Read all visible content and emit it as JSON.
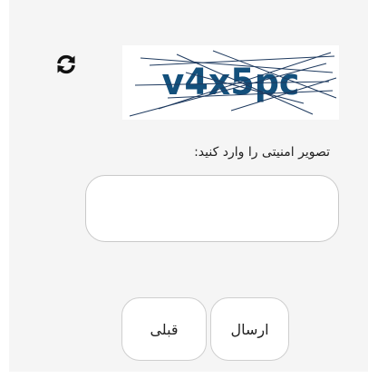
{
  "captcha": {
    "image_text": "v4x5pc",
    "refresh_icon": "refresh-icon",
    "text_color": "#13507c"
  },
  "form": {
    "prompt_label": "تصویر امنیتی را وارد کنید:",
    "input_value": "",
    "input_placeholder": ""
  },
  "buttons": {
    "submit_label": "ارسال",
    "prev_label": "قبلی"
  }
}
